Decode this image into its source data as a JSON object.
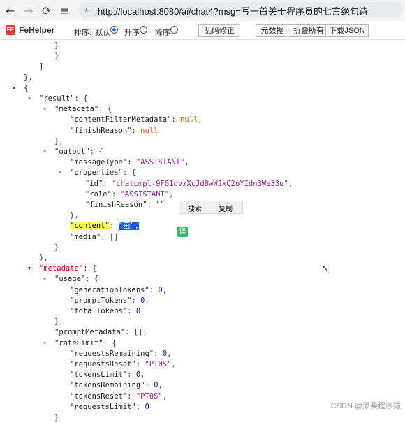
{
  "browser": {
    "back_icon": "←",
    "forward_icon": "→",
    "reload_icon": "⟳",
    "tune_icon": "≡",
    "lock_icon": "⌕",
    "url": "http://localhost:8080/ai/chat4?msg=写一首关于程序员的七言绝句诗"
  },
  "fehelper": {
    "logo": "FE",
    "name": "FeHelper",
    "sort_label": "排序:",
    "sort_default": "默认",
    "sort_asc": "升序",
    "sort_desc": "降序",
    "sort_selected": "默认",
    "btn_fix": "乱码修正",
    "btn_raw": "元数据",
    "btn_fold": "折叠所有",
    "btn_download": "下载JSON"
  },
  "json_view": {
    "colors": {
      "key": "#222222",
      "string": "#8b1c8b",
      "number": "#1a1aa6",
      "null": "#d4600a",
      "toggle_active": "#cc0000"
    },
    "lines": [
      {
        "tokens": [
          {
            "t": "}",
            "c": "punc"
          }
        ]
      },
      {
        "tokens": [
          {
            "t": "}",
            "c": "punc"
          }
        ]
      },
      {
        "tokens": [
          {
            "t": "]",
            "c": "punc"
          }
        ]
      },
      {
        "tokens": [
          {
            "t": "},",
            "c": "punc"
          }
        ]
      },
      {
        "toggle": true,
        "toggle_active": true,
        "tokens": [
          {
            "t": "{",
            "c": "punc"
          }
        ]
      },
      {
        "toggle": true,
        "tokens": [
          {
            "t": "\"result\"",
            "c": "key"
          },
          {
            "t": ": {",
            "c": "punc"
          }
        ]
      },
      {
        "toggle": true,
        "tokens": [
          {
            "t": "\"metadata\"",
            "c": "key"
          },
          {
            "t": ": {",
            "c": "punc"
          }
        ]
      },
      {
        "tokens": [
          {
            "t": "\"contentFilterMetadata\"",
            "c": "key"
          },
          {
            "t": ": ",
            "c": "punc"
          },
          {
            "t": "null",
            "c": "nul"
          },
          {
            "t": ",",
            "c": "punc"
          }
        ]
      },
      {
        "tokens": [
          {
            "t": "\"finishReason\"",
            "c": "key"
          },
          {
            "t": ": ",
            "c": "punc"
          },
          {
            "t": "null",
            "c": "nul"
          }
        ]
      },
      {
        "tokens": [
          {
            "t": "},",
            "c": "punc"
          }
        ]
      },
      {
        "toggle": true,
        "tokens": [
          {
            "t": "\"output\"",
            "c": "key"
          },
          {
            "t": ": {",
            "c": "punc"
          }
        ]
      },
      {
        "tokens": [
          {
            "t": "\"messageType\"",
            "c": "key"
          },
          {
            "t": ": ",
            "c": "punc"
          },
          {
            "t": "\"ASSISTANT\"",
            "c": "str"
          },
          {
            "t": ",",
            "c": "punc"
          }
        ]
      },
      {
        "toggle": true,
        "tokens": [
          {
            "t": "\"properties\"",
            "c": "key"
          },
          {
            "t": ": {",
            "c": "punc"
          }
        ]
      },
      {
        "tokens": [
          {
            "t": "\"id\"",
            "c": "key"
          },
          {
            "t": ": ",
            "c": "punc"
          },
          {
            "t": "\"chatcmpl-9F01qvxXcJd8wWJkQ2oYIdn3We33u\"",
            "c": "str"
          },
          {
            "t": ",",
            "c": "punc"
          }
        ]
      },
      {
        "tokens": [
          {
            "t": "\"role\"",
            "c": "key"
          },
          {
            "t": ": ",
            "c": "punc"
          },
          {
            "t": "\"ASSISTANT\"",
            "c": "str"
          },
          {
            "t": ",",
            "c": "punc"
          }
        ]
      },
      {
        "tokens": [
          {
            "t": "\"finishReason\"",
            "c": "key"
          },
          {
            "t": ": ",
            "c": "punc"
          },
          {
            "t": "\"\"",
            "c": "str"
          }
        ]
      },
      {
        "tokens": [
          {
            "t": "},",
            "c": "punc"
          }
        ]
      },
      {
        "tokens": [
          {
            "t": "\"content\"",
            "c": "hl-key"
          },
          {
            "t": ": ",
            "c": "punc"
          },
          {
            "t": "\"画\",",
            "c": "hl-val"
          }
        ]
      },
      {
        "tokens": [
          {
            "t": "\"media\"",
            "c": "key"
          },
          {
            "t": ": []",
            "c": "punc"
          }
        ]
      },
      {
        "tokens": [
          {
            "t": "}",
            "c": "punc"
          }
        ]
      },
      {
        "tokens": [
          {
            "t": "},",
            "c": "punc"
          }
        ]
      },
      {
        "toggle": true,
        "toggle_active": true,
        "tokens": [
          {
            "t": "\"metadata\"",
            "c": "key"
          },
          {
            "t": ": {",
            "c": "punc"
          }
        ]
      },
      {
        "toggle": true,
        "tokens": [
          {
            "t": "\"usage\"",
            "c": "key"
          },
          {
            "t": ": {",
            "c": "punc"
          }
        ]
      },
      {
        "tokens": [
          {
            "t": "\"generationTokens\"",
            "c": "key"
          },
          {
            "t": ": ",
            "c": "punc"
          },
          {
            "t": "0",
            "c": "num"
          },
          {
            "t": ",",
            "c": "punc"
          }
        ]
      },
      {
        "tokens": [
          {
            "t": "\"promptTokens\"",
            "c": "key"
          },
          {
            "t": ": ",
            "c": "punc"
          },
          {
            "t": "0",
            "c": "num"
          },
          {
            "t": ",",
            "c": "punc"
          }
        ]
      },
      {
        "tokens": [
          {
            "t": "\"totalTokens\"",
            "c": "key"
          },
          {
            "t": ": ",
            "c": "punc"
          },
          {
            "t": "0",
            "c": "num"
          }
        ]
      },
      {
        "tokens": [
          {
            "t": "},",
            "c": "punc"
          }
        ]
      },
      {
        "tokens": [
          {
            "t": "\"promptMetadata\"",
            "c": "key"
          },
          {
            "t": ": [],",
            "c": "punc"
          }
        ]
      },
      {
        "toggle": true,
        "tokens": [
          {
            "t": "\"rateLimit\"",
            "c": "key"
          },
          {
            "t": ": {",
            "c": "punc"
          }
        ]
      },
      {
        "tokens": [
          {
            "t": "\"requestsRemaining\"",
            "c": "key"
          },
          {
            "t": ": ",
            "c": "punc"
          },
          {
            "t": "0",
            "c": "num"
          },
          {
            "t": ",",
            "c": "punc"
          }
        ]
      },
      {
        "tokens": [
          {
            "t": "\"requestsReset\"",
            "c": "key"
          },
          {
            "t": ": ",
            "c": "punc"
          },
          {
            "t": "\"PT0S\"",
            "c": "str"
          },
          {
            "t": ",",
            "c": "punc"
          }
        ]
      },
      {
        "tokens": [
          {
            "t": "\"tokensLimit\"",
            "c": "key"
          },
          {
            "t": ": ",
            "c": "punc"
          },
          {
            "t": "0",
            "c": "num"
          },
          {
            "t": ",",
            "c": "punc"
          }
        ]
      },
      {
        "tokens": [
          {
            "t": "\"tokensRemaining\"",
            "c": "key"
          },
          {
            "t": ": ",
            "c": "punc"
          },
          {
            "t": "0",
            "c": "num"
          },
          {
            "t": ",",
            "c": "punc"
          }
        ]
      },
      {
        "tokens": [
          {
            "t": "\"tokensReset\"",
            "c": "key"
          },
          {
            "t": ": ",
            "c": "punc"
          },
          {
            "t": "\"PT0S\"",
            "c": "str"
          },
          {
            "t": ",",
            "c": "punc"
          }
        ]
      },
      {
        "tokens": [
          {
            "t": "\"requestsLimit\"",
            "c": "key"
          },
          {
            "t": ": ",
            "c": "punc"
          },
          {
            "t": "0",
            "c": "num"
          }
        ]
      },
      {
        "tokens": [
          {
            "t": "}",
            "c": "punc"
          }
        ]
      }
    ]
  },
  "popup": {
    "search": "搜索",
    "copy": "复制"
  },
  "translate_icon": "译",
  "cursor_icon": "↖",
  "watermark": "CSDN @添柴程序猿"
}
